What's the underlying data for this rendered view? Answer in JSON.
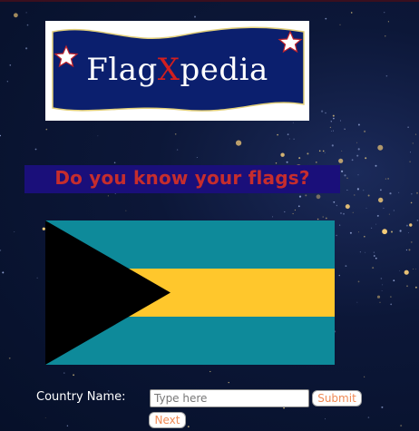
{
  "logo": {
    "name_part1": "Flag",
    "name_x": "X",
    "name_part2": "pedia",
    "colors": {
      "banner": "#0b1f6e",
      "x_letter": "#d21f1f",
      "star": "#ffffff",
      "star_outline": "#c0232b"
    }
  },
  "heading": "Do you know your flags?",
  "flag": {
    "colors": {
      "aquamarine": "#0e8a9a",
      "gold": "#ffc72c",
      "black": "#000000"
    }
  },
  "form": {
    "label": "Country Name:",
    "input_value": "",
    "input_placeholder": "Type here",
    "submit_label": "Submit",
    "next_label": "Next"
  },
  "theme": {
    "heading_bg": "#1a0f7a",
    "heading_text": "#c62d2d",
    "button_text": "#f08a55"
  }
}
